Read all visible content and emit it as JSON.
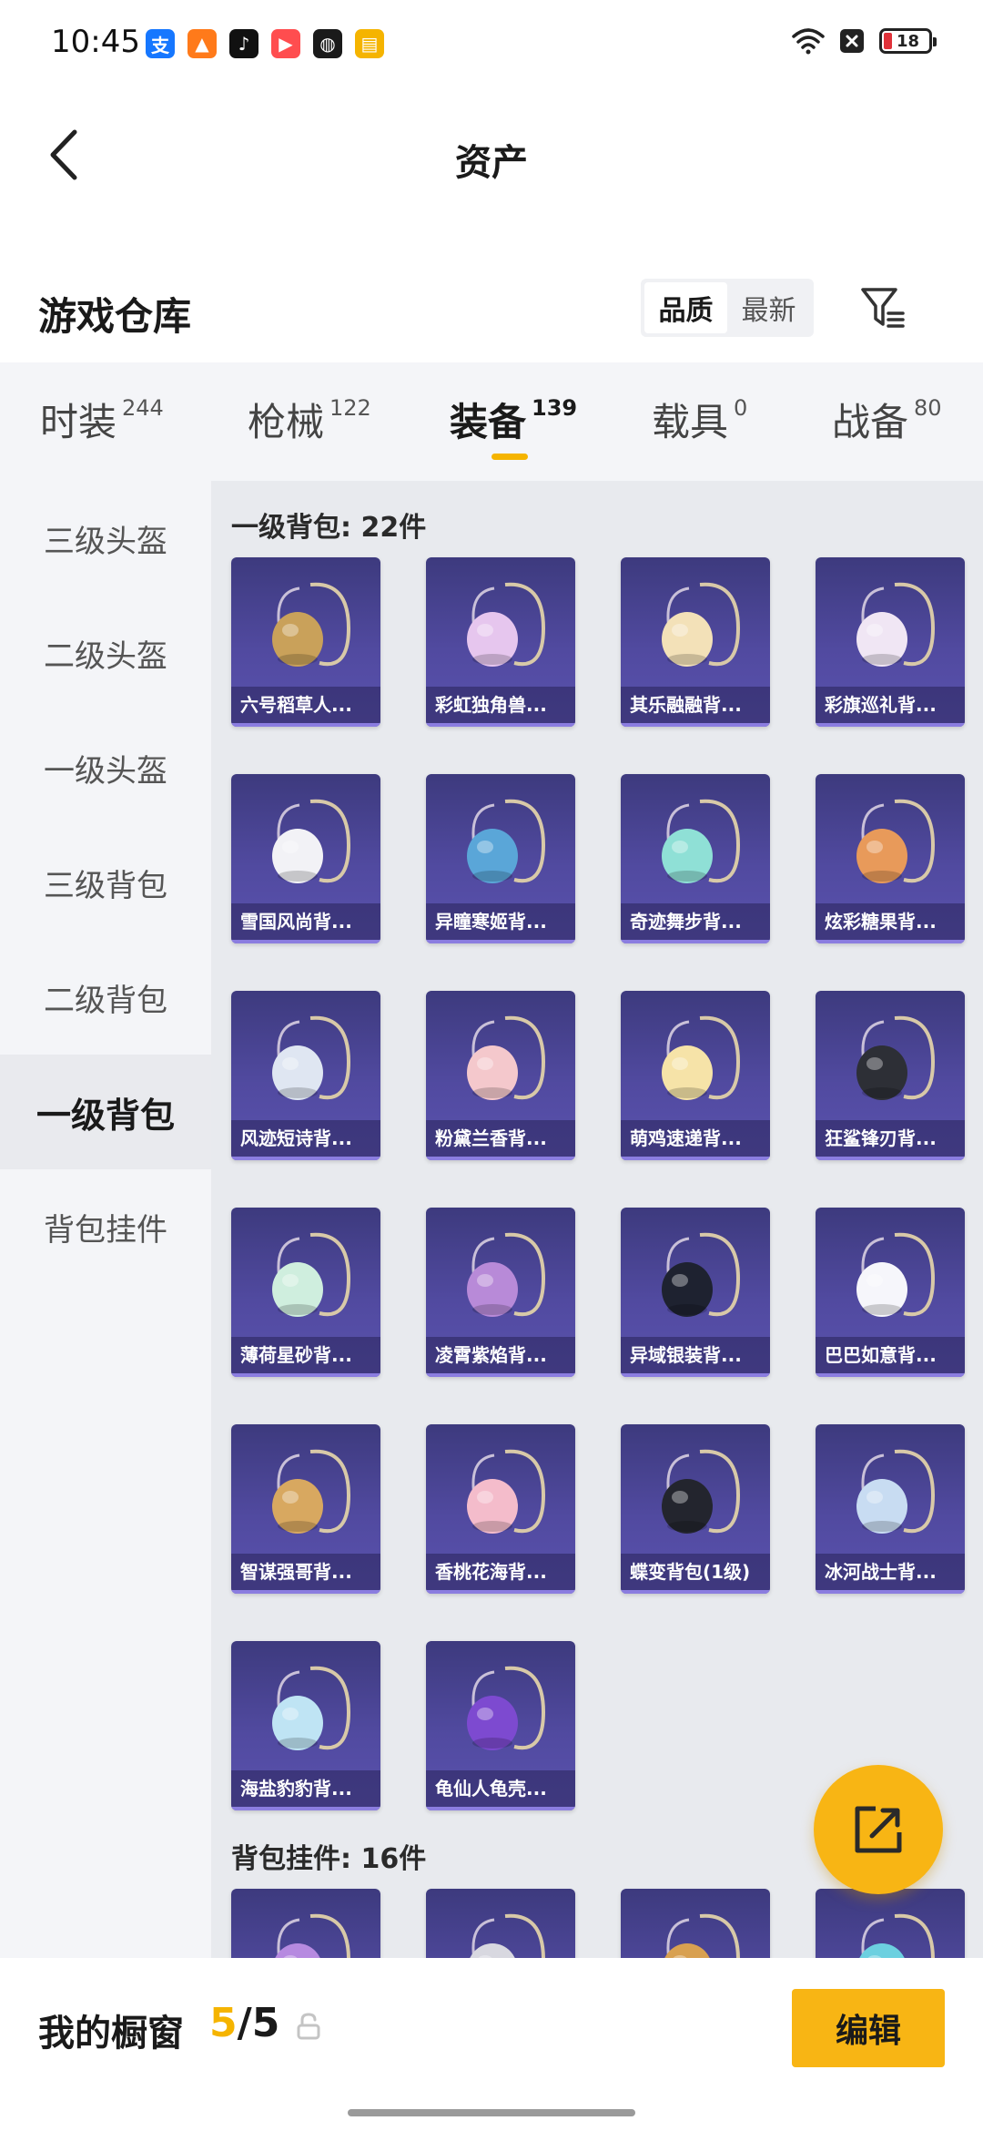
{
  "status_bar": {
    "time": "10:45",
    "battery": "18",
    "app_icons": [
      "alipay-icon",
      "flame-app-icon",
      "tiktok-icon",
      "video-app-icon",
      "wechat-icon",
      "reader-app-icon"
    ]
  },
  "header": {
    "title": "资产"
  },
  "warehouse": {
    "title": "游戏仓库",
    "sort_options": [
      {
        "label": "品质",
        "active": true
      },
      {
        "label": "最新",
        "active": false
      }
    ]
  },
  "category_tabs": [
    {
      "label": "时装",
      "count": "244",
      "active": false
    },
    {
      "label": "枪械",
      "count": "122",
      "active": false
    },
    {
      "label": "装备",
      "count": "139",
      "active": true
    },
    {
      "label": "载具",
      "count": "0",
      "active": false
    },
    {
      "label": "战备",
      "count": "80",
      "active": false
    }
  ],
  "sidebar": {
    "items": [
      {
        "label": "三级头盔",
        "active": false
      },
      {
        "label": "二级头盔",
        "active": false
      },
      {
        "label": "一级头盔",
        "active": false
      },
      {
        "label": "三级背包",
        "active": false
      },
      {
        "label": "二级背包",
        "active": false
      },
      {
        "label": "一级背包",
        "active": true
      },
      {
        "label": "背包挂件",
        "active": false
      }
    ]
  },
  "groups": [
    {
      "title": "一级背包: 22件",
      "items": [
        {
          "label": "六号稻草人...",
          "color": "#c9a15a"
        },
        {
          "label": "彩虹独角兽...",
          "color": "#e6c6ee"
        },
        {
          "label": "其乐融融背...",
          "color": "#f3e1b8"
        },
        {
          "label": "彩旗巡礼背...",
          "color": "#f0e6f4"
        },
        {
          "label": "雪国风尚背...",
          "color": "#f2f2f6"
        },
        {
          "label": "异瞳寒姬背...",
          "color": "#5aa6d8"
        },
        {
          "label": "奇迹舞步背...",
          "color": "#8fe0d6"
        },
        {
          "label": "炫彩糖果背...",
          "color": "#e89a5a"
        },
        {
          "label": "风迹短诗背...",
          "color": "#dfe6f2"
        },
        {
          "label": "粉黛兰香背...",
          "color": "#f4c8cc"
        },
        {
          "label": "萌鸡速递背...",
          "color": "#f6e3a8"
        },
        {
          "label": "狂鲨锋刃背...",
          "color": "#2d2f36"
        },
        {
          "label": "薄荷星砂背...",
          "color": "#cfeede"
        },
        {
          "label": "凌霄紫焰背...",
          "color": "#b88ad8"
        },
        {
          "label": "异域银装背...",
          "color": "#1e2230"
        },
        {
          "label": "巴巴如意背...",
          "color": "#f6f6fb"
        },
        {
          "label": "智谋强哥背...",
          "color": "#d8a860"
        },
        {
          "label": "香桃花海背...",
          "color": "#f4bccb"
        },
        {
          "label": "蝶变背包(1级)",
          "color": "#23252e"
        },
        {
          "label": "冰河战士背...",
          "color": "#c8dcf2"
        },
        {
          "label": "海盐豹豹背...",
          "color": "#bfe4f4"
        },
        {
          "label": "龟仙人龟壳...",
          "color": "#7d4ad0"
        }
      ]
    },
    {
      "title": "背包挂件: 16件",
      "items": [
        {
          "label": "",
          "color": "#b68ae0"
        },
        {
          "label": "",
          "color": "#d8d8e0"
        },
        {
          "label": "",
          "color": "#d8a050"
        },
        {
          "label": "",
          "color": "#6cd0e0"
        }
      ]
    }
  ],
  "showcase": {
    "label": "我的橱窗",
    "current": "5",
    "separator": "/",
    "total": "5",
    "edit_label": "编辑"
  }
}
